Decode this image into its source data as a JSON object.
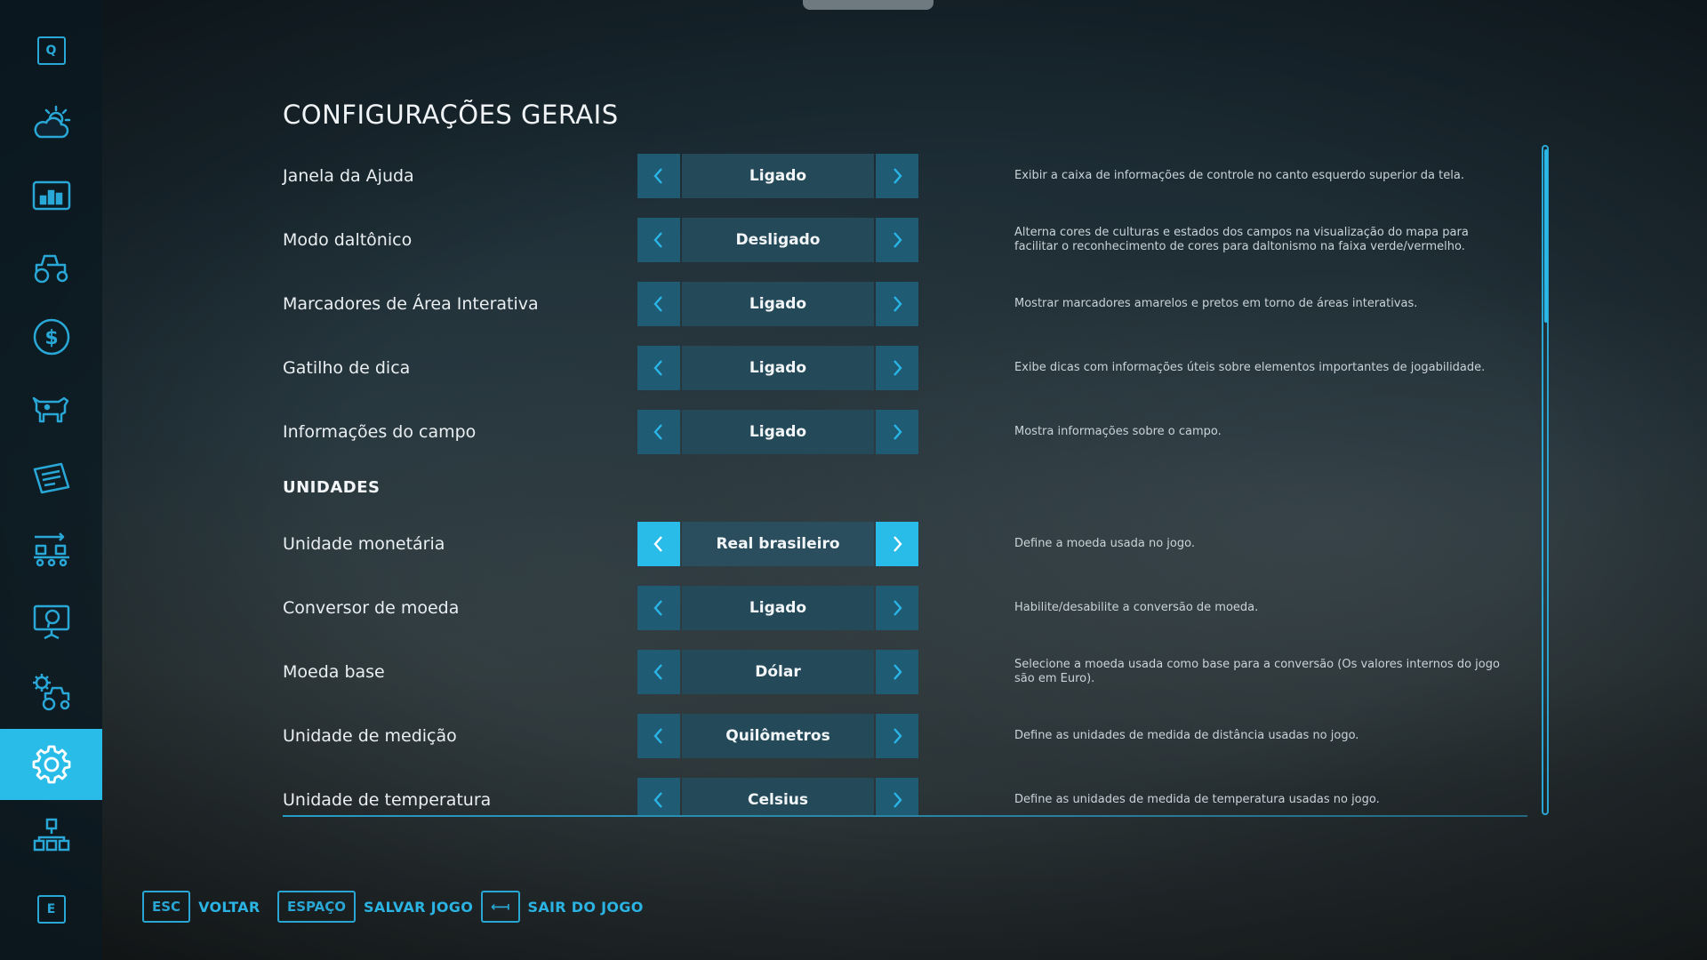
{
  "page": {
    "title": "CONFIGURAÇÕES GERAIS"
  },
  "sidebar": {
    "top_key": "Q",
    "bottom_key": "E",
    "items": [
      {
        "icon": "weather-icon"
      },
      {
        "icon": "statistics-icon"
      },
      {
        "icon": "tractor-icon"
      },
      {
        "icon": "finances-icon"
      },
      {
        "icon": "animals-icon"
      },
      {
        "icon": "contracts-icon"
      },
      {
        "icon": "production-icon"
      },
      {
        "icon": "tutorial-icon"
      },
      {
        "icon": "vehicle-settings-icon"
      },
      {
        "icon": "settings-gear-icon",
        "active": true
      },
      {
        "icon": "network-icon"
      }
    ]
  },
  "settings": {
    "general": [
      {
        "label": "Janela da Ajuda",
        "value": "Ligado",
        "description": "Exibir a caixa de informações de controle no canto esquerdo superior da tela."
      },
      {
        "label": "Modo daltônico",
        "value": "Desligado",
        "description": "Alterna cores de culturas e estados dos campos na visualização do mapa para facilitar o reconhecimento de cores para daltonismo na faixa verde/vermelho."
      },
      {
        "label": "Marcadores de Área Interativa",
        "value": "Ligado",
        "description": "Mostrar marcadores amarelos e pretos em torno de áreas interativas."
      },
      {
        "label": "Gatilho de dica",
        "value": "Ligado",
        "description": "Exibe dicas com informações úteis sobre elementos importantes de jogabilidade."
      },
      {
        "label": "Informações do campo",
        "value": "Ligado",
        "description": "Mostra informações sobre o campo."
      }
    ],
    "units_header": "UNIDADES",
    "units": [
      {
        "label": "Unidade monetária",
        "value": "Real brasileiro",
        "description": "Define a moeda usada no jogo.",
        "focused": true
      },
      {
        "label": "Conversor de moeda",
        "value": "Ligado",
        "description": "Habilite/desabilite a conversão de moeda."
      },
      {
        "label": "Moeda base",
        "value": "Dólar",
        "description": "Selecione a moeda usada como base para a conversão (Os valores internos do jogo são em Euro)."
      },
      {
        "label": "Unidade de medição",
        "value": "Quilômetros",
        "description": "Define as unidades de medida de distância usadas no jogo."
      },
      {
        "label": "Unidade de temperatura",
        "value": "Celsius",
        "description": "Define as unidades de medida de temperatura usadas no jogo."
      }
    ]
  },
  "footer": {
    "back": {
      "key": "ESC",
      "label": "VOLTAR"
    },
    "save": {
      "key": "ESPAÇO",
      "label": "SALVAR JOGO"
    },
    "quit": {
      "key": "⟻",
      "label": "SAIR DO JOGO"
    }
  },
  "colors": {
    "accent": "#29bce8",
    "arrow_bg": "#1f5b73",
    "value_bg": "#244a5a"
  }
}
